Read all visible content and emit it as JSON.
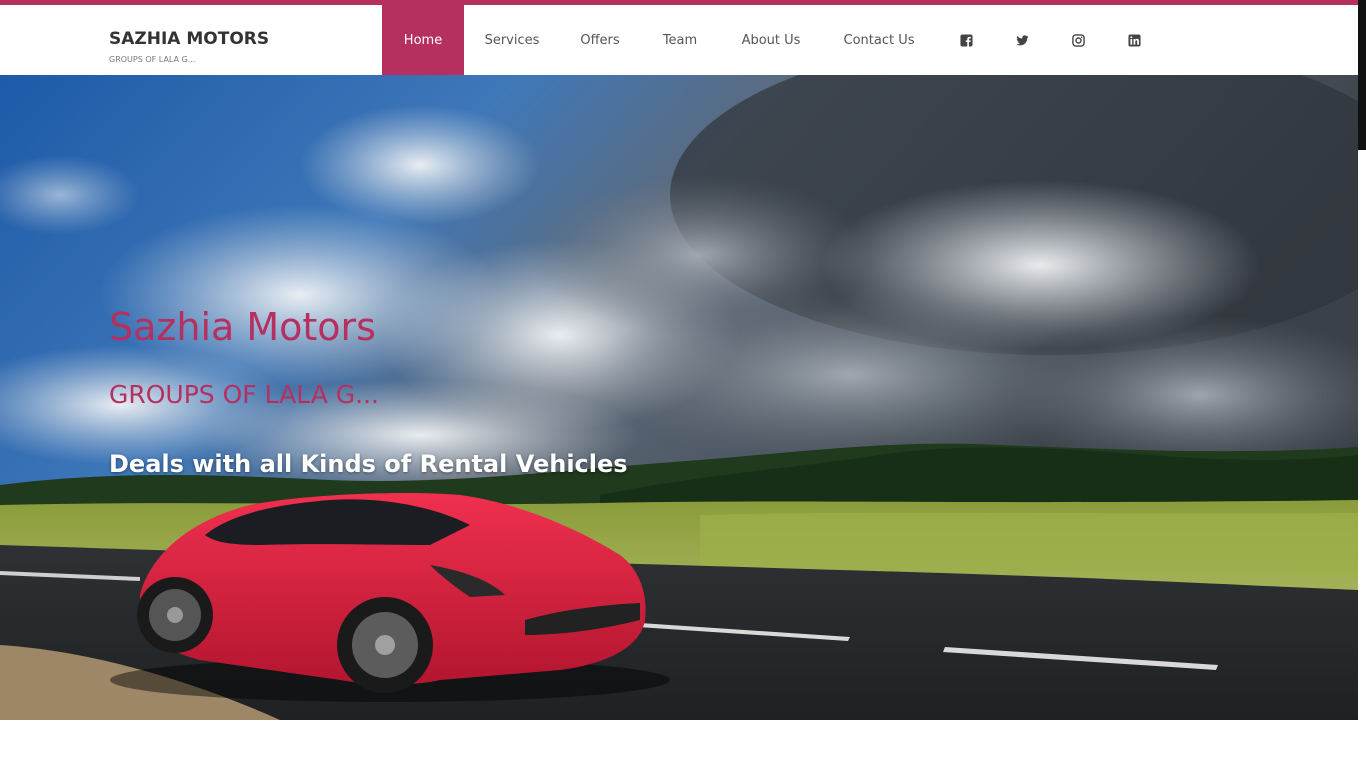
{
  "brand": {
    "title": "SAZHIA MOTORS",
    "subtitle": "GROUPS OF LALA G..."
  },
  "nav": {
    "items": [
      {
        "label": "Home",
        "active": true
      },
      {
        "label": "Services",
        "active": false
      },
      {
        "label": "Offers",
        "active": false
      },
      {
        "label": "Team",
        "active": false
      },
      {
        "label": "About Us",
        "active": false
      },
      {
        "label": "Contact Us",
        "active": false
      }
    ],
    "social_icons": [
      "facebook-icon",
      "twitter-icon",
      "instagram-icon",
      "linkedin-icon"
    ]
  },
  "hero": {
    "title": "Sazhia Motors",
    "subtitle": "GROUPS OF LALA G...",
    "tagline": "Deals with all Kinds of Rental Vehicles",
    "image_description_icon": "red-sports-car-on-road-image"
  },
  "colors": {
    "accent": "#b5305f",
    "nav_text": "#555555",
    "brand_text": "#333333"
  }
}
